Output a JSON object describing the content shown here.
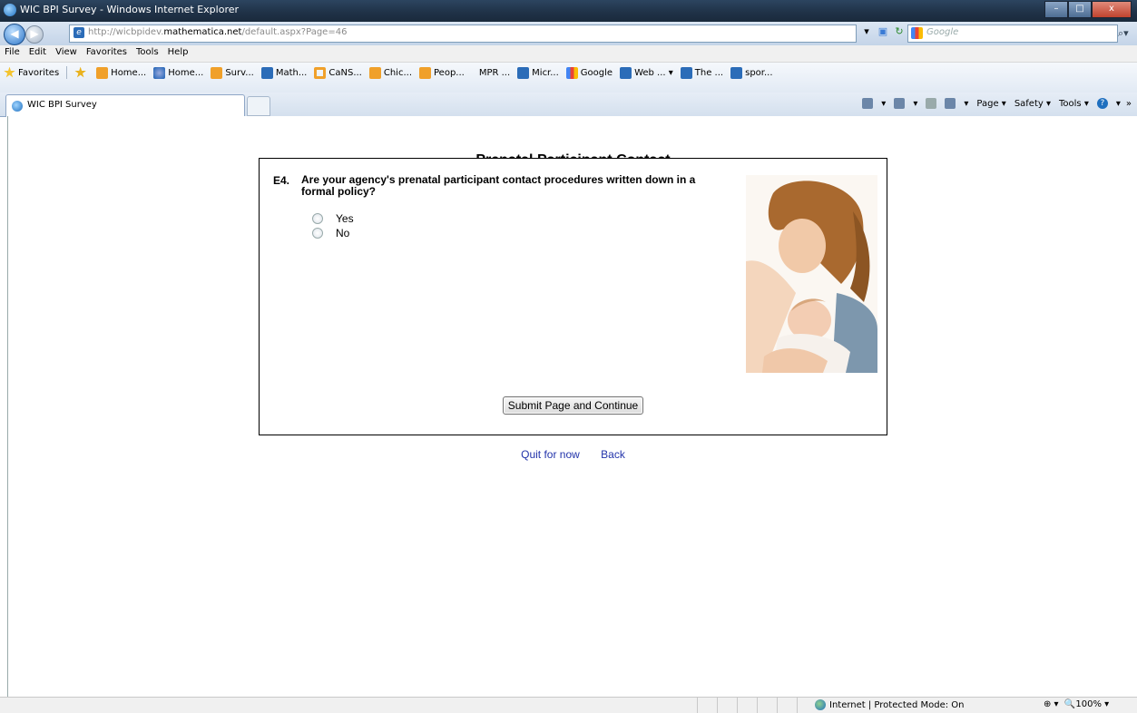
{
  "window": {
    "title": "WIC BPI Survey - Windows Internet Explorer"
  },
  "address": {
    "url_prefix": "http://wicbpidev.",
    "url_domain": "mathematica.net",
    "url_path": "/default.aspx?Page=46"
  },
  "search": {
    "placeholder": "Google"
  },
  "menu": [
    "File",
    "Edit",
    "View",
    "Favorites",
    "Tools",
    "Help"
  ],
  "favorites": {
    "label": "Favorites",
    "items": [
      {
        "label": "Home...",
        "icon": "rss-icon"
      },
      {
        "label": "Home...",
        "icon": "home-icon"
      },
      {
        "label": "Surv...",
        "icon": "rss-icon"
      },
      {
        "label": "Math...",
        "icon": "ie-icon"
      },
      {
        "label": "CaNS...",
        "icon": "ring-icon"
      },
      {
        "label": "Chic...",
        "icon": "rss-icon"
      },
      {
        "label": "Peop...",
        "icon": "rss-icon"
      },
      {
        "label": "MPR ...",
        "icon": "none"
      },
      {
        "label": "Micr...",
        "icon": "ie-icon"
      },
      {
        "label": "Google",
        "icon": "google-icon"
      },
      {
        "label": "Web ... ▾",
        "icon": "ie-icon"
      },
      {
        "label": "The ...",
        "icon": "ie-icon"
      },
      {
        "label": "spor...",
        "icon": "ie-icon"
      }
    ]
  },
  "tab": {
    "title": "WIC BPI Survey"
  },
  "commandbar": {
    "page": "Page ▾",
    "safety": "Safety ▾",
    "tools": "Tools ▾"
  },
  "page": {
    "title": "Prenatal Participant Contact",
    "question": {
      "number": "E4.",
      "text": "Are your agency's prenatal participant contact procedures written down in a formal policy?",
      "options": [
        "Yes",
        "No"
      ]
    },
    "submit_label": "Submit Page and Continue",
    "links": {
      "quit": "Quit for now",
      "back": "Back"
    }
  },
  "status": {
    "zone": "Internet | Protected Mode: On",
    "zoom": "100%"
  }
}
